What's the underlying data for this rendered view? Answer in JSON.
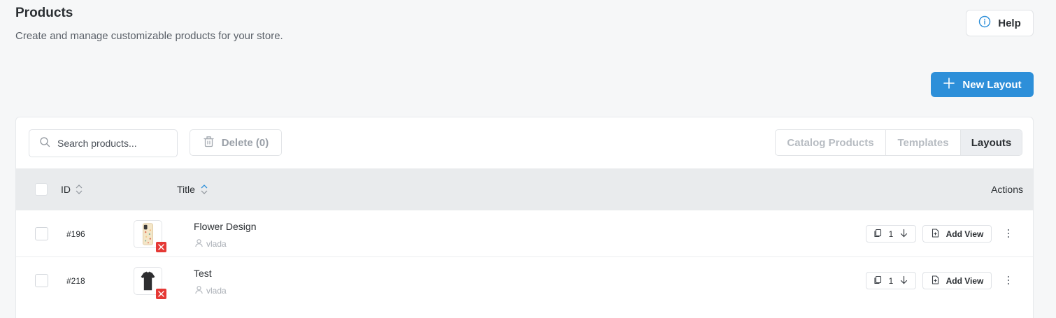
{
  "header": {
    "title": "Products",
    "subtitle": "Create and manage customizable products for your store.",
    "help_label": "Help",
    "new_layout_label": "New Layout"
  },
  "toolbar": {
    "search_placeholder": "Search products...",
    "delete_label": "Delete (0)",
    "tabs": [
      {
        "label": "Catalog Products",
        "active": false
      },
      {
        "label": "Templates",
        "active": false
      },
      {
        "label": "Layouts",
        "active": true
      }
    ]
  },
  "table": {
    "columns": {
      "id": "ID",
      "title": "Title",
      "actions": "Actions"
    },
    "rows": [
      {
        "id": "#196",
        "title": "Flower Design",
        "owner": "vlada",
        "thumbnail": "phone-case-floral",
        "count": "1",
        "add_view_label": "Add View"
      },
      {
        "id": "#218",
        "title": "Test",
        "owner": "vlada",
        "thumbnail": "black-tshirt",
        "count": "1",
        "add_view_label": "Add View"
      }
    ]
  },
  "colors": {
    "accent": "#2d8fd9",
    "danger": "#e53935",
    "header_bg": "#e9ebed",
    "page_bg": "#f6f7f8"
  }
}
